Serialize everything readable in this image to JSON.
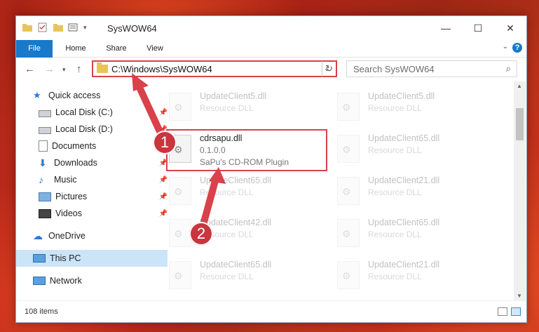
{
  "window": {
    "title": "SysWOW64"
  },
  "ribbon": {
    "tabs": [
      "File",
      "Home",
      "Share",
      "View"
    ]
  },
  "navbar": {
    "address": "C:\\Windows\\SysWOW64",
    "search_placeholder": "Search SysWOW64"
  },
  "sidebar": {
    "items": [
      {
        "label": "Quick access",
        "pinned": false
      },
      {
        "label": "Local Disk (C:)",
        "pinned": true
      },
      {
        "label": "Local Disk (D:)",
        "pinned": true
      },
      {
        "label": "Documents",
        "pinned": true
      },
      {
        "label": "Downloads",
        "pinned": true
      },
      {
        "label": "Music",
        "pinned": true
      },
      {
        "label": "Pictures",
        "pinned": true
      },
      {
        "label": "Videos",
        "pinned": true
      },
      {
        "label": "OneDrive",
        "pinned": false
      },
      {
        "label": "This PC",
        "pinned": false,
        "selected": true
      },
      {
        "label": "Network",
        "pinned": false
      }
    ]
  },
  "files": {
    "c1r0": {
      "name": "UpdateClient5.dll",
      "desc": "Resource DLL"
    },
    "c2r0": {
      "name": "UpdateClient5.dll",
      "desc": "Resource DLL"
    },
    "highlight": {
      "name": "cdrsapu.dll",
      "version": "0.1.0.0",
      "desc": "SaPu's CD-ROM Plugin"
    },
    "c2r1": {
      "name": "UpdateClient65.dll",
      "desc": "Resource DLL"
    },
    "c1r2": {
      "name": "UpdateClient65.dll",
      "desc": "Resource DLL"
    },
    "c2r2": {
      "name": "UpdateClient21.dll",
      "desc": "Resource DLL"
    },
    "c1r3": {
      "name": "UpdateClient42.dll",
      "desc": "Resource DLL"
    },
    "c2r3": {
      "name": "UpdateClient65.dll",
      "desc": "Resource DLL"
    },
    "c1r4": {
      "name": "UpdateClient65.dll",
      "desc": "Resource DLL"
    },
    "c2r4": {
      "name": "UpdateClient21.dll",
      "desc": "Resource DLL"
    }
  },
  "status": {
    "count": "108 items"
  },
  "badges": {
    "one": "1",
    "two": "2"
  },
  "colors": {
    "accent": "#1979ca",
    "highlight": "#d9414b",
    "selected": "#cce4f7"
  }
}
